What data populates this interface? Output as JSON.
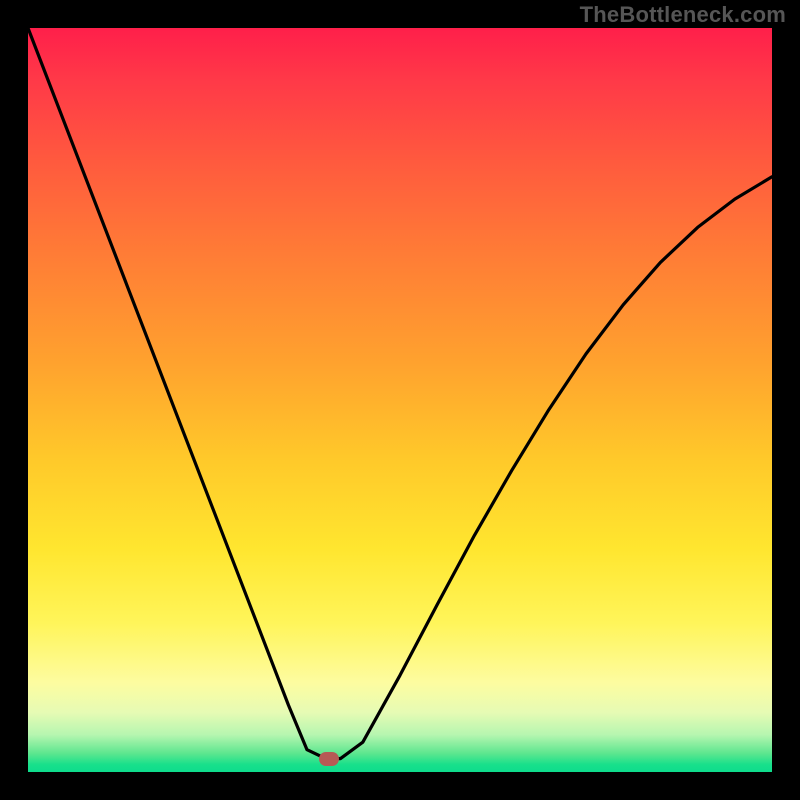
{
  "watermark": "TheBottleneck.com",
  "chart_data": {
    "type": "line",
    "title": "",
    "xlabel": "",
    "ylabel": "",
    "xlim": [
      0,
      1
    ],
    "ylim": [
      0,
      1
    ],
    "grid": false,
    "legend": false,
    "axes_visible": false,
    "min_point": {
      "x": 0.405,
      "y": 0.983
    },
    "series": [
      {
        "name": "bottleneck-curve",
        "x": [
          0.0,
          0.05,
          0.1,
          0.15,
          0.2,
          0.25,
          0.3,
          0.35,
          0.375,
          0.4,
          0.42,
          0.45,
          0.5,
          0.55,
          0.6,
          0.65,
          0.7,
          0.75,
          0.8,
          0.85,
          0.9,
          0.95,
          1.0
        ],
        "y": [
          1.0,
          0.87,
          0.74,
          0.61,
          0.48,
          0.35,
          0.22,
          0.09,
          0.03,
          0.018,
          0.018,
          0.04,
          0.13,
          0.225,
          0.318,
          0.405,
          0.487,
          0.562,
          0.628,
          0.685,
          0.732,
          0.77,
          0.8
        ]
      }
    ],
    "marker": {
      "x": 0.405,
      "y": 0.018,
      "color": "#b65a55"
    },
    "gradient_stops": [
      {
        "pos": 0.0,
        "color": "#ff1f4a"
      },
      {
        "pos": 0.18,
        "color": "#ff5a3e"
      },
      {
        "pos": 0.45,
        "color": "#ffa22e"
      },
      {
        "pos": 0.7,
        "color": "#ffe62f"
      },
      {
        "pos": 0.88,
        "color": "#fdfca0"
      },
      {
        "pos": 0.95,
        "color": "#b6f6b0"
      },
      {
        "pos": 1.0,
        "color": "#0edc8c"
      }
    ]
  }
}
